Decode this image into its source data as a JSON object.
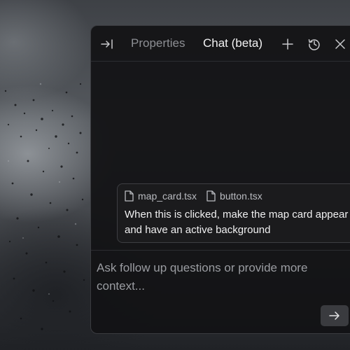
{
  "panel": {
    "tabs": {
      "properties": "Properties",
      "chat": "Chat (beta)"
    },
    "icons": {
      "collapse": "collapse-panel-icon",
      "add": "plus-icon",
      "history": "history-icon",
      "close": "close-icon",
      "file": "file-icon",
      "send": "arrow-right-icon"
    }
  },
  "message": {
    "files": [
      "map_card.tsx",
      "button.tsx"
    ],
    "text": "When this is clicked, make the map card appear and have an active background"
  },
  "composer": {
    "placeholder": "Ask follow up questions or provide more context..."
  },
  "colors": {
    "panel_bg": "#121214",
    "border": "#3a3b3f",
    "active_tab": "#f2f2f3",
    "inactive_tab": "#8d8f94"
  }
}
